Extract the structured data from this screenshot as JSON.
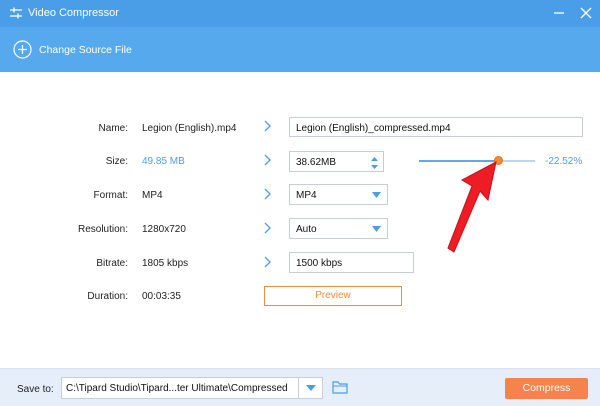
{
  "window": {
    "title": "Video Compressor",
    "app_icon": "sliders-icon",
    "minimize_icon": "minimize-icon",
    "close_icon": "close-icon"
  },
  "source": {
    "label": "Change Source File",
    "icon": "add-circle-icon"
  },
  "fields": {
    "name": {
      "label": "Name:",
      "original": "Legion (English).mp4",
      "new_value": "Legion (English)_compressed.mp4"
    },
    "size": {
      "label": "Size:",
      "original": "49.85 MB",
      "new_value": "38.62MB",
      "percent_change": "-22.52%",
      "slider_fraction": 0.68
    },
    "format": {
      "label": "Format:",
      "original": "MP4",
      "selected": "MP4"
    },
    "resolution": {
      "label": "Resolution:",
      "original": "1280x720",
      "selected": "Auto"
    },
    "bitrate": {
      "label": "Bitrate:",
      "original": "1805 kbps",
      "new_value": "1500 kbps"
    },
    "duration": {
      "label": "Duration:",
      "value": "00:03:35"
    }
  },
  "preview_label": "Preview",
  "footer": {
    "save_label": "Save to:",
    "path": "C:\\Tipard Studio\\Tipard...ter Ultimate\\Compressed",
    "compress_label": "Compress"
  },
  "colors": {
    "titlebar": "#4a9ee8",
    "accent_blue": "#4a9ee8",
    "accent_orange": "#f28b3a",
    "compress_button": "#f5834b",
    "annotation_arrow": "#ee1c24"
  }
}
